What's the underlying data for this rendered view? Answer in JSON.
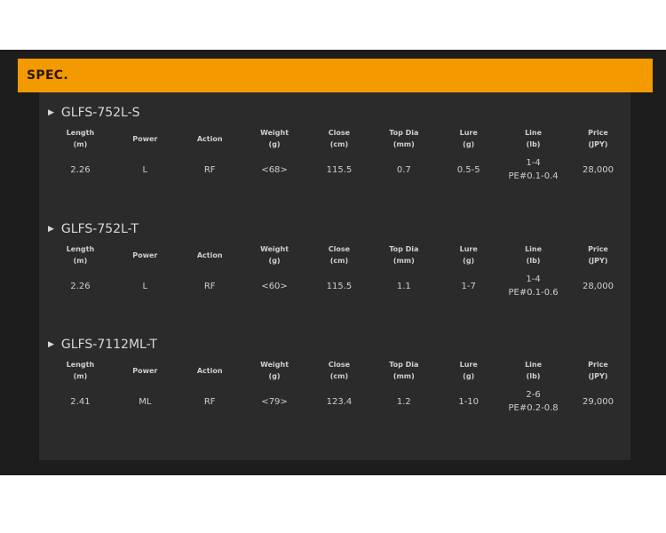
{
  "header": {
    "title": "SPEC."
  },
  "columns": [
    {
      "label": "Length",
      "unit": "(m)"
    },
    {
      "label": "Power",
      "unit": ""
    },
    {
      "label": "Action",
      "unit": ""
    },
    {
      "label": "Weight",
      "unit": "(g)"
    },
    {
      "label": "Close",
      "unit": "(cm)"
    },
    {
      "label": "Top Dia",
      "unit": "(mm)"
    },
    {
      "label": "Lure",
      "unit": "(g)"
    },
    {
      "label": "Line",
      "unit": "(lb)"
    },
    {
      "label": "Price",
      "unit": "(JPY)"
    }
  ],
  "models": [
    {
      "name": "GLFS-752L-S",
      "values": [
        "2.26",
        "L",
        "RF",
        "<68>",
        "115.5",
        "0.7",
        "0.5-5",
        "1-4",
        "28,000"
      ],
      "line_pe": "PE#0.1-0.4"
    },
    {
      "name": "GLFS-752L-T",
      "values": [
        "2.26",
        "L",
        "RF",
        "<60>",
        "115.5",
        "1.1",
        "1-7",
        "1-4",
        "28,000"
      ],
      "line_pe": "PE#0.1-0.6"
    },
    {
      "name": "GLFS-7112ML-T",
      "values": [
        "2.41",
        "ML",
        "RF",
        "<79>",
        "123.4",
        "1.2",
        "1-10",
        "2-6",
        "29,000"
      ],
      "line_pe": "PE#0.2-0.8"
    }
  ]
}
